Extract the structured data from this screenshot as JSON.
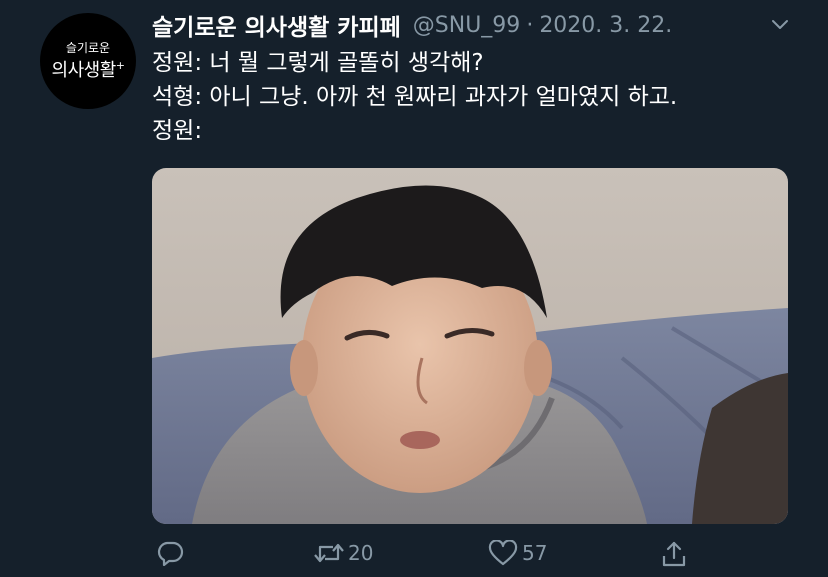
{
  "avatar": {
    "line1": "슬기로운",
    "line2": "의사생활",
    "mark": "+"
  },
  "header": {
    "display_name": "슬기로운 의사생활 카피페",
    "handle": "@SNU_99",
    "separator": "·",
    "date": "2020. 3. 22."
  },
  "tweet": {
    "lines": [
      "정원: 너 뭘 그렇게 골똘히 생각해?",
      "석형: 아니 그냥. 아까 천 원짜리 과자가 얼마였지 하고.",
      "정원:"
    ]
  },
  "actions": {
    "reply": {
      "icon": "reply-icon"
    },
    "retweet": {
      "icon": "retweet-icon",
      "count": "20"
    },
    "like": {
      "icon": "heart-icon",
      "count": "57"
    },
    "share": {
      "icon": "share-icon"
    }
  },
  "colors": {
    "background": "#15202b",
    "text": "#ffffff",
    "muted": "#8899a6"
  }
}
